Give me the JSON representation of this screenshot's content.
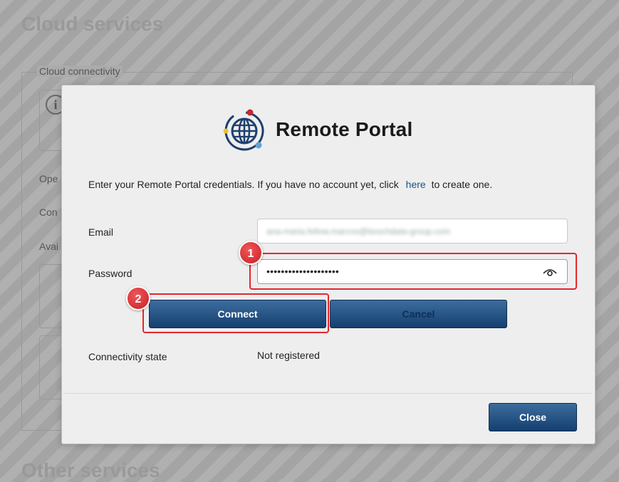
{
  "background": {
    "title": "Cloud services",
    "section_legend": "Cloud connectivity",
    "labels": [
      "Ope",
      "Con",
      "Avai"
    ],
    "footer_title": "Other services"
  },
  "modal": {
    "logo_text": "Remote Portal",
    "intro": {
      "before_link": "Enter your Remote Portal credentials. If you have no account yet, click",
      "link": "here",
      "after_link": "to create one."
    },
    "email": {
      "label": "Email",
      "value": "ana-maria.fellow.marcos@boschdata-group.com"
    },
    "password": {
      "label": "Password",
      "value": "••••••••••••••••••••"
    },
    "connect_label": "Connect",
    "cancel_label": "Cancel",
    "connectivity_state": {
      "label": "Connectivity state",
      "value": "Not registered"
    },
    "close_label": "Close"
  },
  "annotations": {
    "step1": "1",
    "step2": "2",
    "highlight_color": "#e5262b"
  },
  "colors": {
    "button_top": "#3c6d9e",
    "button_bottom": "#143f6f",
    "link": "#1b4f8a"
  }
}
